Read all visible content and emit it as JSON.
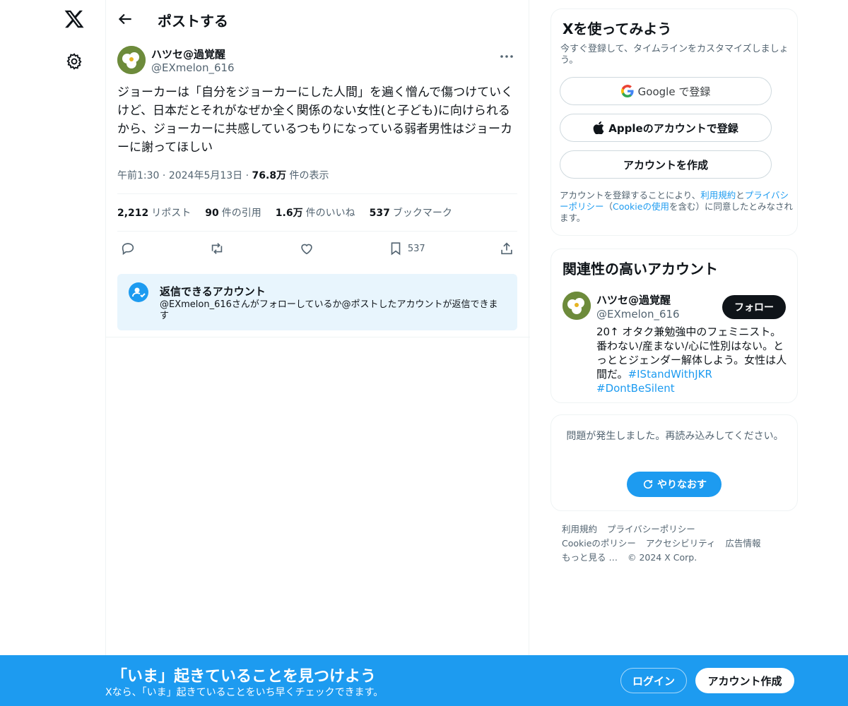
{
  "header": {
    "title": "ポストする"
  },
  "post": {
    "author_name": "ハツセ@過覚醒",
    "author_handle": "@EXmelon_616",
    "text": "ジョーカーは「自分をジョーカーにした人間」を遍く憎んで傷つけていくけど、日本だとそれがなぜか全く関係のない女性(と子ども)に向けられるから、ジョーカーに共感しているつもりになっている弱者男性はジョーカーに謝ってほしい",
    "time": "午前1:30",
    "date": "2024年5月13日",
    "views_count": "76.8万",
    "views_label": "件の表示",
    "stats": {
      "reposts_count": "2,212",
      "reposts_label": "リポスト",
      "quotes_count": "90",
      "quotes_label": "件の引用",
      "likes_count": "1.6万",
      "likes_label": "件のいいね",
      "bookmarks_count": "537",
      "bookmarks_label": "ブックマーク"
    },
    "bookmark_action_count": "537"
  },
  "reply_restriction": {
    "title": "返信できるアカウント",
    "description": "@EXmelon_616さんがフォローしているか@ポストしたアカウントが返信できます"
  },
  "signup_card": {
    "title": "Xを使ってみよう",
    "subtitle": "今すぐ登録して、タイムラインをカスタマイズしましょう。",
    "google_label": "Google で登録",
    "apple_label": "Appleのアカウントで登録",
    "create_label": "アカウントを作成",
    "terms_prefix": "アカウントを登録することにより、",
    "terms_link": "利用規約",
    "terms_and": "と",
    "privacy_link": "プライバシーポリシー",
    "paren_open": "（",
    "cookie_link": "Cookieの使用",
    "terms_suffix": "を含む）に同意したとみなされます。"
  },
  "related": {
    "title": "関連性の高いアカウント",
    "name": "ハツセ@過覚醒",
    "handle": "@EXmelon_616",
    "follow_label": "フォロー",
    "bio": "20↑ オタク兼勉強中のフェミニスト。番わない/産まない/心に性別はない。とっととジェンダー解体しよう。女性は人間だ。",
    "tag1": "#IStandWithJKR",
    "tag2": "#DontBeSilent"
  },
  "error_card": {
    "message": "問題が発生しました。再読み込みしてください。",
    "retry_label": "やりなおす"
  },
  "footer": {
    "terms": "利用規約",
    "privacy": "プライバシーポリシー",
    "cookie": "Cookieのポリシー",
    "accessibility": "アクセシビリティ",
    "ads": "広告情報",
    "more": "もっと見る …",
    "copyright": "© 2024 X Corp."
  },
  "banner": {
    "title": "「いま」起きていることを見つけよう",
    "subtitle": "Xなら、「いま」起きていることをいち早くチェックできます。",
    "login_label": "ログイン",
    "signup_label": "アカウント作成"
  },
  "colors": {
    "accent": "#1d9bf0",
    "text": "#0f1419",
    "secondary": "#536471"
  }
}
